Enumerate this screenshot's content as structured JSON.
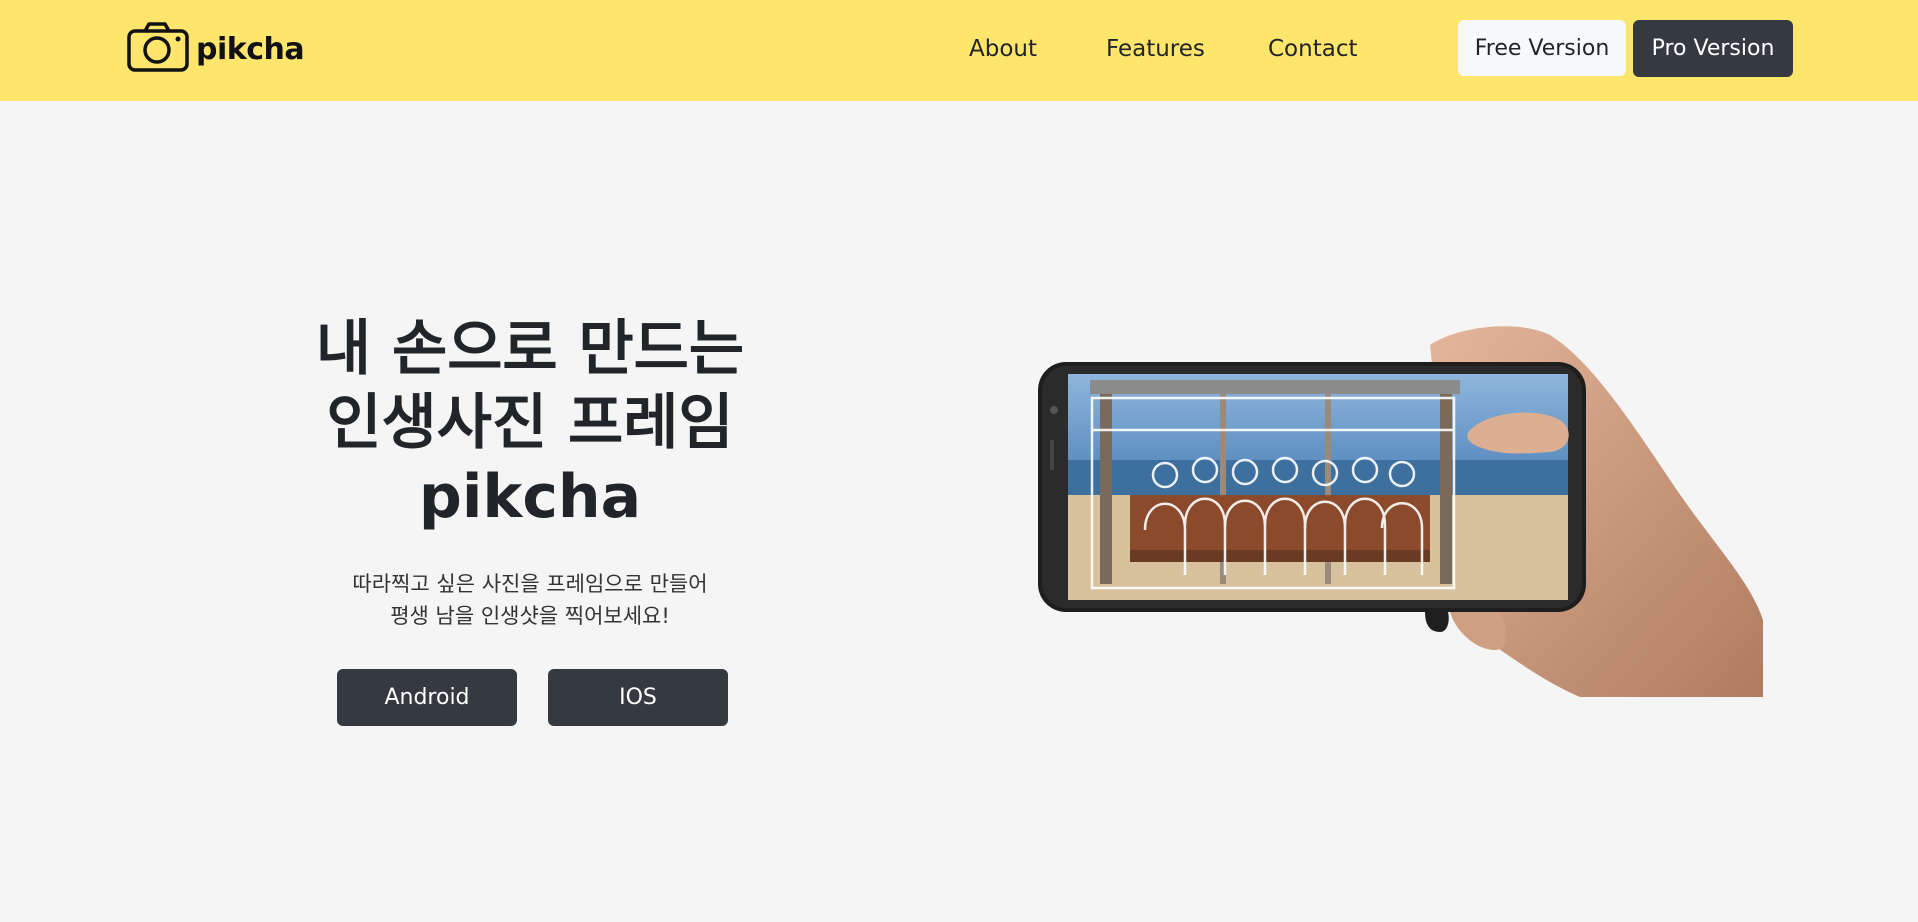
{
  "navbar": {
    "brand": "pikcha",
    "brand_icon": "camera-icon",
    "links": [
      "About",
      "Features",
      "Contact"
    ],
    "free_button": "Free Version",
    "pro_button": "Pro Version",
    "background": "#fee56c"
  },
  "hero": {
    "title_lines": [
      "내 손으로 만드는",
      "인생사진 프레임",
      "pikcha"
    ],
    "subtitle_lines": [
      "따라찍고 싶은 사진을 프레임으로 만들어",
      "평생 남을 인생샷을 찍어보세요!"
    ],
    "android_button": "Android",
    "ios_button": "IOS"
  },
  "colors": {
    "page_background": "#f5f5f5",
    "dark_button": "#343a40",
    "light_button": "#f8f9fa"
  }
}
